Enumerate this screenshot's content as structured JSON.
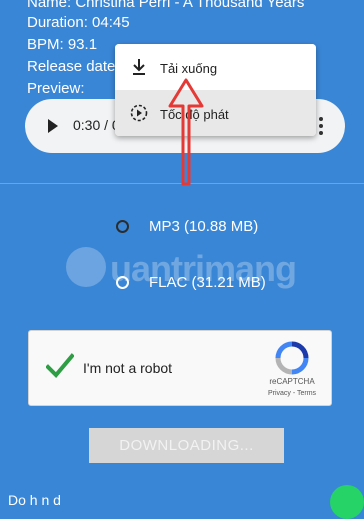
{
  "track_info": {
    "name_line": "Name: Christina Perri - A Thousand Years",
    "duration_line": "Duration: 04:45",
    "bpm_line": "BPM: 93.1",
    "release_line": "Release date",
    "preview_line": "Preview:"
  },
  "player": {
    "time": "0:30 / 0"
  },
  "context_menu": {
    "download_label": "Tải xuống",
    "speed_label": "Tốc độ phát"
  },
  "formats": [
    {
      "label": "MP3 (10.88 MB)",
      "selected": false
    },
    {
      "label": "FLAC (31.21 MB)",
      "selected": false
    }
  ],
  "watermark": "uantrimang",
  "captcha": {
    "label": "I'm not a robot",
    "brand": "reCAPTCHA",
    "links": "Privacy - Terms"
  },
  "download_button": "DOWNLOADING...",
  "colors": {
    "page_bg": "#3a86d6",
    "annotation_arrow": "#e53935",
    "check": "#2e9e44",
    "button_disabled": "#d6d6d6"
  }
}
